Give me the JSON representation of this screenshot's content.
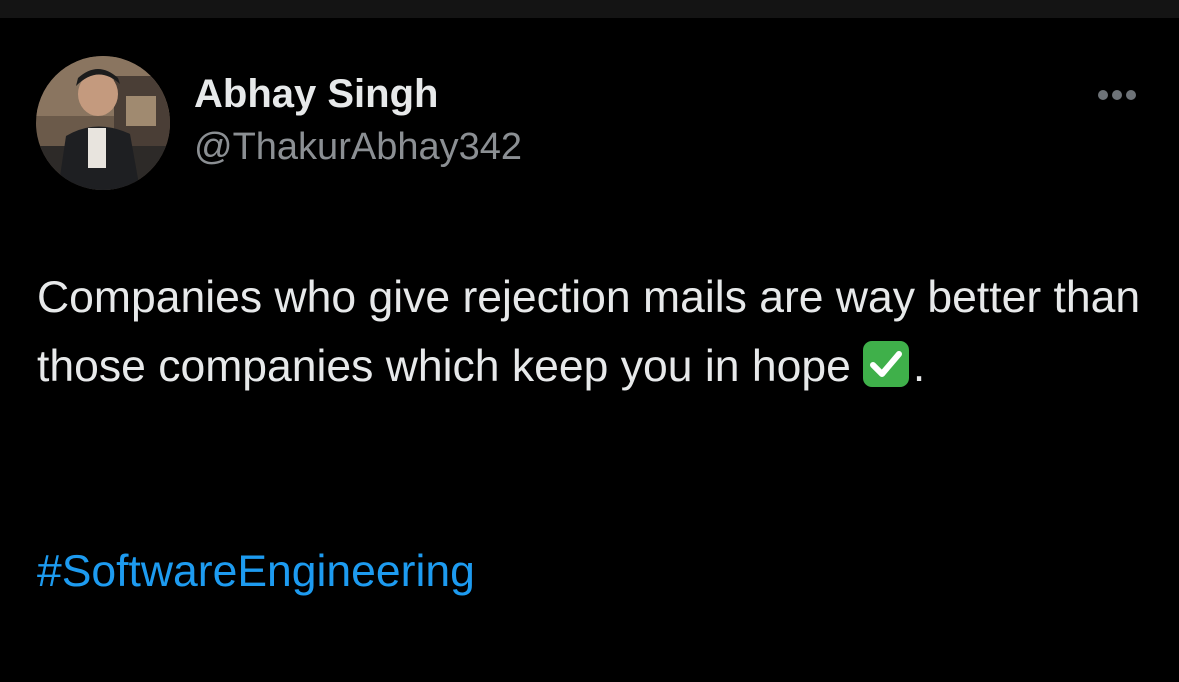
{
  "author": {
    "display_name": "Abhay Singh",
    "handle": "@ThakurAbhay342"
  },
  "tweet": {
    "text": "Companies who give rejection mails are way better than those companies which keep you in hope",
    "emoji": "check-mark-button-emoji",
    "trailing": ".",
    "hashtag": "#SoftwareEngineering"
  },
  "colors": {
    "background": "#000000",
    "primary_text": "#e7e9ea",
    "secondary_text": "#8b8f93",
    "link": "#1d9bf0",
    "emoji_green": "#3fb04a"
  },
  "icons": {
    "more": "more-horizontal-icon"
  }
}
